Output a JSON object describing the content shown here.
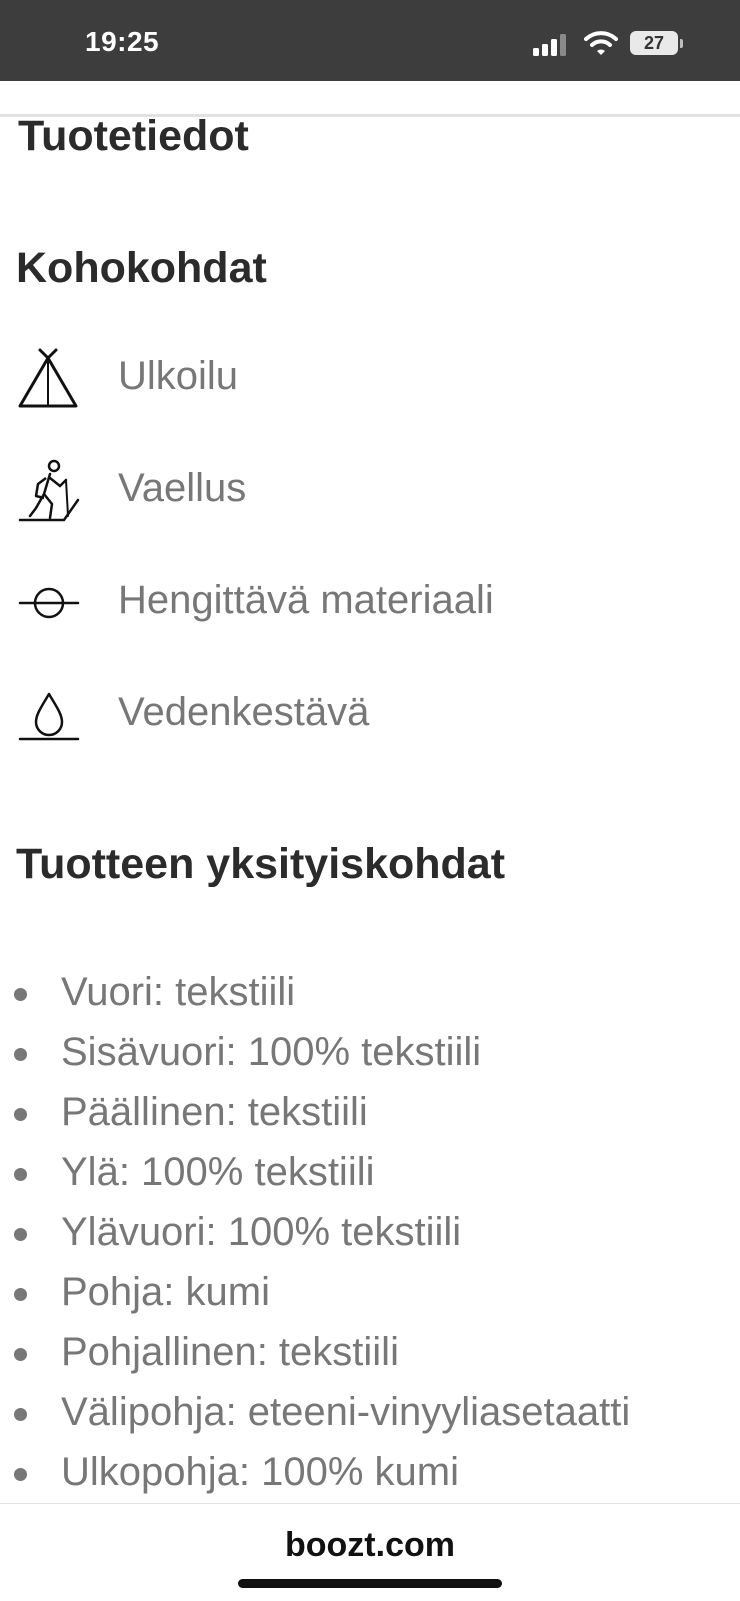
{
  "status_bar": {
    "time": "19:25",
    "battery": "27"
  },
  "page": {
    "title": "Tuotetiedot"
  },
  "highlights": {
    "title": "Kohokohdat",
    "items": [
      {
        "icon": "tent-icon",
        "label": "Ulkoilu"
      },
      {
        "icon": "hiker-icon",
        "label": "Vaellus"
      },
      {
        "icon": "breathable-icon",
        "label": "Hengittävä materiaali"
      },
      {
        "icon": "water-drop-icon",
        "label": "Vedenkestävä"
      }
    ]
  },
  "details": {
    "title": "Tuotteen yksityiskohdat",
    "items": [
      "Vuori: tekstiili",
      "Sisävuori: 100% tekstiili",
      "Päällinen: tekstiili",
      "Ylä: 100% tekstiili",
      "Ylävuori: 100% tekstiili",
      "Pohja: kumi",
      "Pohjallinen: tekstiili",
      "Välipohja: eteeni-vinyyliasetaatti",
      "Ulkopohja: 100% kumi"
    ]
  },
  "footer": {
    "domain": "boozt.com"
  }
}
